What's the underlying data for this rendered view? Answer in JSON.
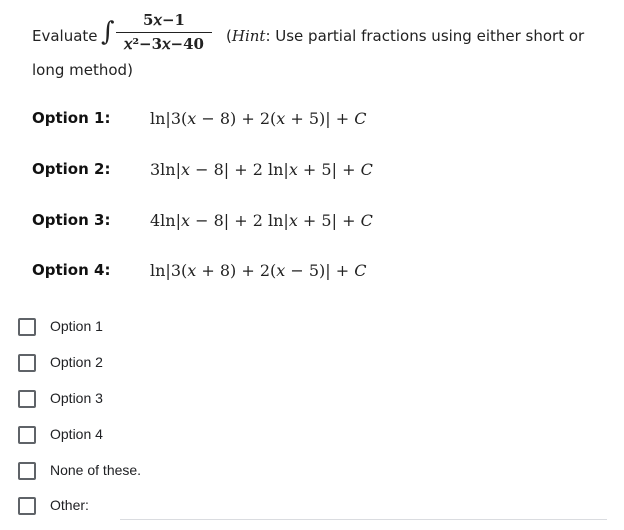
{
  "question": {
    "prefix": "Evaluate",
    "integral_symbol": "∫",
    "numerator": "5𝑥−1",
    "denominator": "𝑥²−3𝑥−40",
    "hint_open": "(",
    "hint_word": "Hint",
    "hint_text": ": Use partial fractions using either short or",
    "hint_continued": "long method)"
  },
  "options": [
    {
      "label": "Option 1:",
      "expression": "ln|3(𝑥 − 8) + 2(𝑥 + 5)| + 𝐶"
    },
    {
      "label": "Option 2:",
      "expression": "3ln|𝑥 − 8| + 2 ln|𝑥 + 5| + 𝐶"
    },
    {
      "label": "Option 3:",
      "expression": "4ln|𝑥 − 8| + 2 ln|𝑥 + 5| + 𝐶"
    },
    {
      "label": "Option 4:",
      "expression": "ln|3(𝑥 + 8) + 2(𝑥 − 5)| + 𝐶"
    }
  ],
  "choices": [
    {
      "label": "Option 1",
      "checked": false
    },
    {
      "label": "Option 2",
      "checked": false
    },
    {
      "label": "Option 3",
      "checked": false
    },
    {
      "label": "Option 4",
      "checked": false
    },
    {
      "label": "None of these.",
      "checked": false
    },
    {
      "label": "Other:",
      "checked": false
    }
  ],
  "other_input": {
    "value": "",
    "placeholder": ""
  },
  "colors": {
    "checkbox_border": "#5f6368",
    "input_underline": "#dadce0",
    "text": "#202124"
  }
}
